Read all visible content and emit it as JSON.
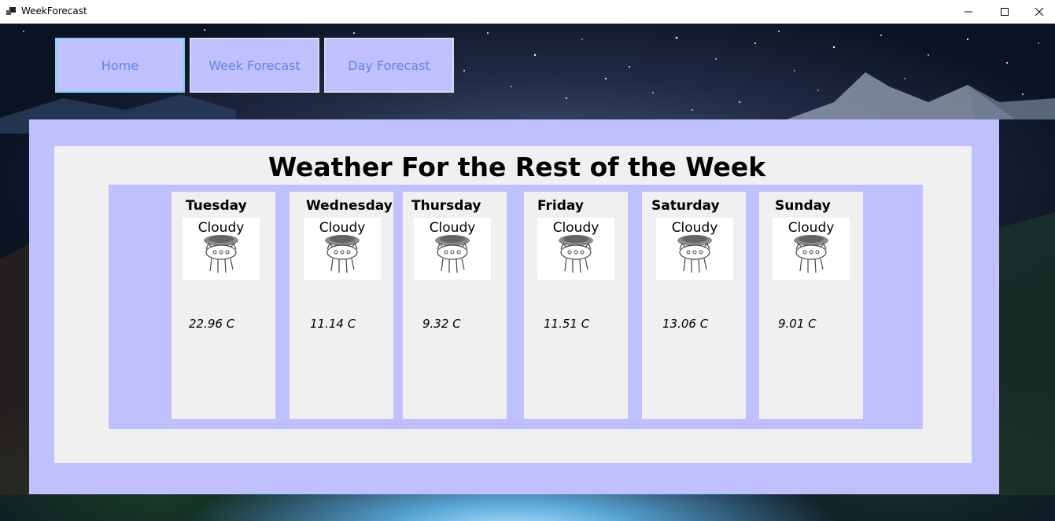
{
  "window": {
    "title": "WeekForecast",
    "controls": [
      "minimize",
      "maximize",
      "close"
    ]
  },
  "nav": {
    "home_label": "Home",
    "week_label": "Week Forecast",
    "day_label": "Day Forecast"
  },
  "main": {
    "title": "Weather For the Rest of the Week"
  },
  "forecast": [
    {
      "day": "Tuesday",
      "condition": "Cloudy",
      "temp": "22.96 C"
    },
    {
      "day": "Wednesday",
      "condition": "Cloudy",
      "temp": "11.14 C"
    },
    {
      "day": "Thursday",
      "condition": "Cloudy",
      "temp": "9.32 C"
    },
    {
      "day": "Friday",
      "condition": "Cloudy",
      "temp": "11.51 C"
    },
    {
      "day": "Saturday",
      "condition": "Cloudy",
      "temp": "13.06 C"
    },
    {
      "day": "Sunday",
      "condition": "Cloudy",
      "temp": "9.01 C"
    }
  ],
  "icons": {
    "condition_icon": "cloudy-cat-icon",
    "app_icon": "app-window-icon"
  },
  "colors": {
    "panel": "#c0c0ff",
    "card": "#f0f0f0",
    "nav_text": "#5b86e5"
  }
}
